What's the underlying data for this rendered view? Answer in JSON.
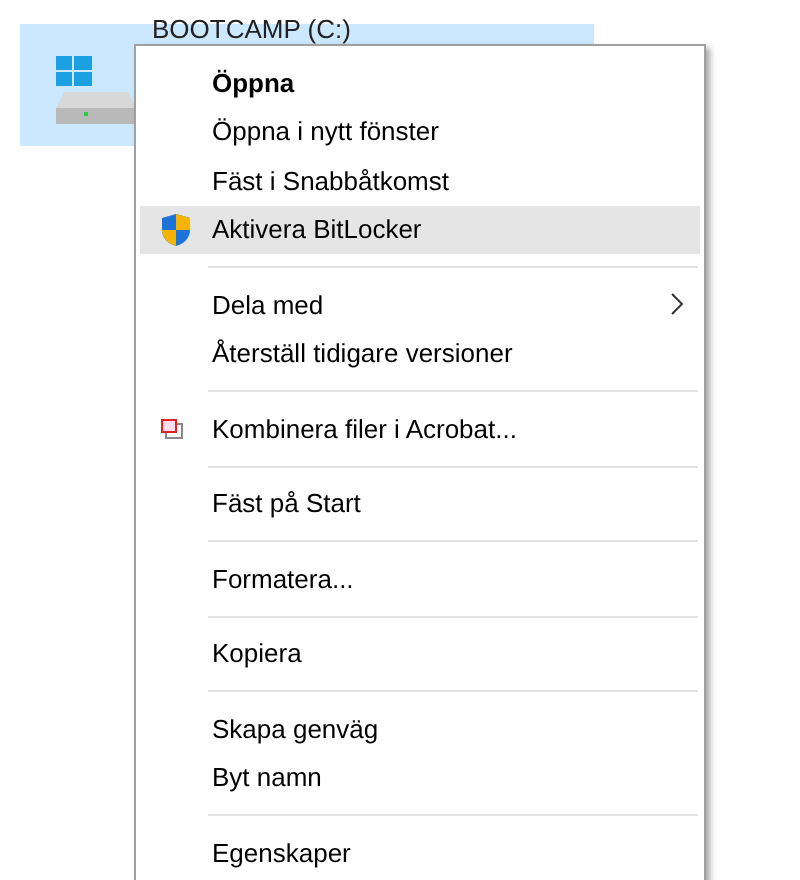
{
  "drive": {
    "label": "BOOTCAMP (C:)",
    "selected": true
  },
  "menu": [
    {
      "kind": "default",
      "label": "Öppna",
      "selected": false
    },
    {
      "kind": "plain",
      "label": "Öppna i nytt fönster",
      "selected": false
    },
    {
      "kind": "plain",
      "label": "Fäst i Snabbåtkomst",
      "selected": false
    },
    {
      "kind": "shield",
      "label": "Aktivera BitLocker",
      "selected": true
    },
    {
      "kind": "separator"
    },
    {
      "kind": "submenu",
      "label": "Dela med",
      "selected": false
    },
    {
      "kind": "plain",
      "label": "Återställ tidigare versioner",
      "selected": false
    },
    {
      "kind": "separator"
    },
    {
      "kind": "acrobat",
      "label": "Kombinera filer i Acrobat...",
      "selected": false
    },
    {
      "kind": "separator"
    },
    {
      "kind": "plain",
      "label": "Fäst på Start",
      "selected": false
    },
    {
      "kind": "separator"
    },
    {
      "kind": "plain",
      "label": "Formatera...",
      "selected": false
    },
    {
      "kind": "separator"
    },
    {
      "kind": "plain",
      "label": "Kopiera",
      "selected": false
    },
    {
      "kind": "separator"
    },
    {
      "kind": "plain",
      "label": "Skapa genväg",
      "selected": false
    },
    {
      "kind": "plain",
      "label": "Byt namn",
      "selected": false
    },
    {
      "kind": "separator"
    },
    {
      "kind": "plain",
      "label": "Egenskaper",
      "selected": false
    }
  ]
}
